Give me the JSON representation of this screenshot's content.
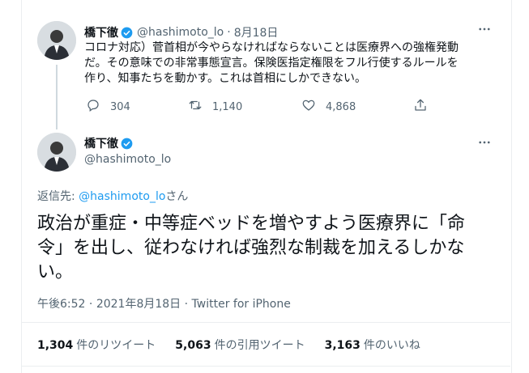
{
  "reply_tweet": {
    "author_name": "橋下徹",
    "handle": "@hashimoto_lo",
    "date": "8月18日",
    "text_lines": [
      "コロナ対応）菅首相が今やらなければならないことは医療界への強権発動",
      "だ。その意味での非常事態宣言。保険医指定権限をフル行使するルールを",
      "作り、知事たちを動かす。これは首相にしかできない。"
    ],
    "replies": "304",
    "retweets": "1,140",
    "likes": "4,868"
  },
  "main_tweet": {
    "author_name": "橋下徹",
    "handle": "@hashimoto_lo",
    "reply_prefix": "返信先: ",
    "reply_handle": "@hashimoto_lo",
    "reply_suffix": "さん",
    "text_lines": [
      "政治が重症・中等症ベッドを増やすよう医療界に「命",
      "令」を出し、従わなければ強烈な制裁を加えるしかな",
      "い。"
    ],
    "time": "午後6:52",
    "date": "2021年8月18日",
    "source": "Twitter for iPhone",
    "stats": [
      {
        "count": "1,304",
        "label": "件のリツイート"
      },
      {
        "count": "5,063",
        "label": "件の引用ツイート"
      },
      {
        "count": "3,163",
        "label": "件のいいね"
      }
    ]
  },
  "colors": {
    "accent": "#1d9bf0",
    "secondary": "#536471",
    "text": "#0f1419",
    "border": "#ebeef0"
  },
  "icons": [
    "more-icon",
    "reply-icon",
    "retweet-icon",
    "like-icon",
    "share-icon",
    "verified-badge-icon"
  ]
}
